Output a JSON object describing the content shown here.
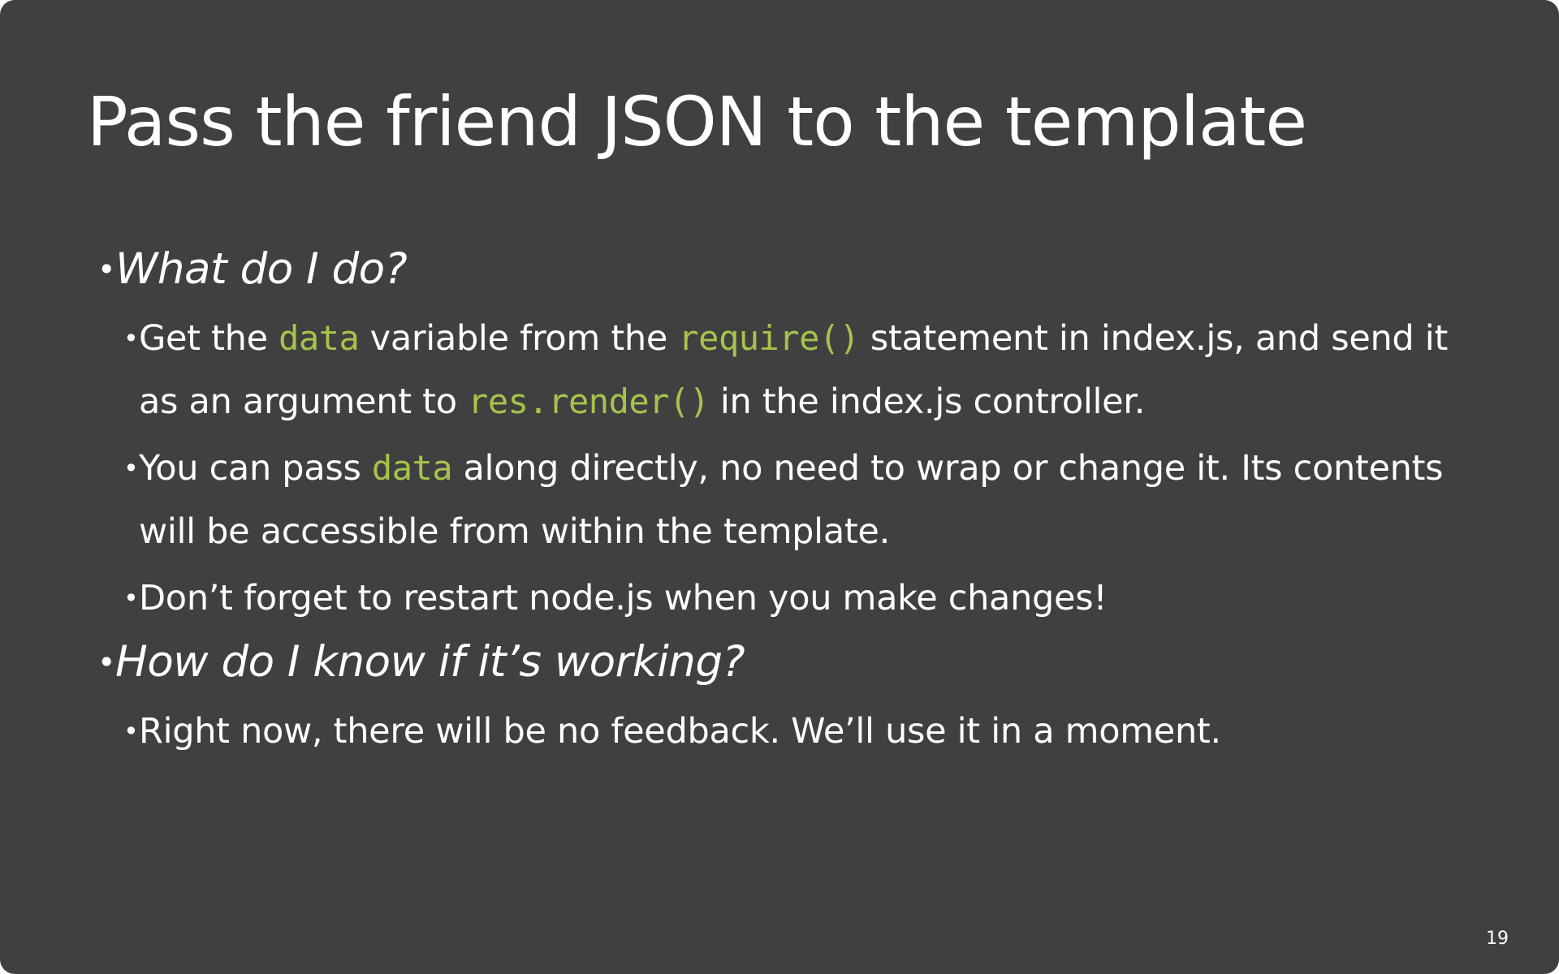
{
  "slide": {
    "title": "Pass the friend JSON to the template",
    "page_number": "19",
    "bullet_glyph": "•",
    "q1": "What do I do?",
    "b1": {
      "t1": "Get the ",
      "c1": "data",
      "t2": " variable from the ",
      "c2": "require()",
      "t3": " statement in index.js, and send it as an argument to ",
      "c3": "res.render()",
      "t4": " in the index.js controller."
    },
    "b2": {
      "t1": "You can pass ",
      "c1": "data",
      "t2": " along directly, no need to wrap or change it. Its contents will be accessible from within the template."
    },
    "b3": "Don’t forget to restart node.js when you make changes!",
    "q2": "How do I know if it’s working?",
    "b4": "Right now, there will be no feedback. We’ll use it in a moment."
  },
  "colors": {
    "background": "#404040",
    "text": "#ffffff",
    "code": "#a6c44b"
  }
}
